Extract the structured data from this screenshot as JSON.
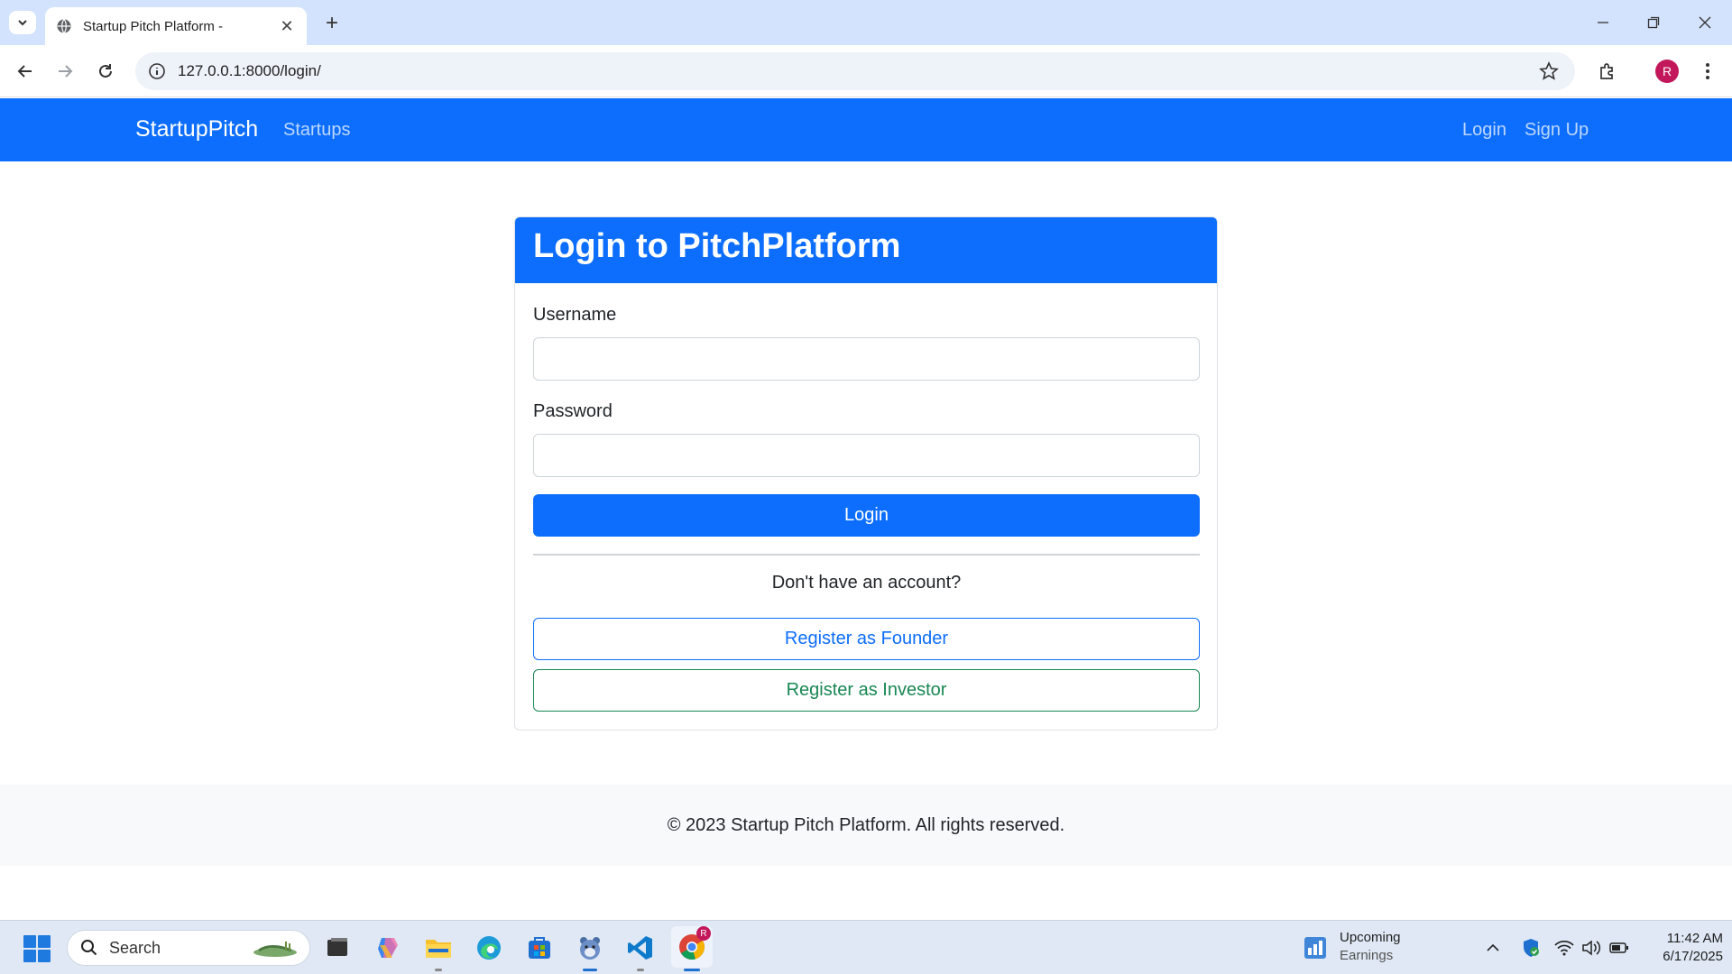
{
  "browser": {
    "tab_title": "Startup Pitch Platform -",
    "url": "127.0.0.1:8000/login/",
    "profile_initial": "R"
  },
  "navbar": {
    "brand": "StartupPitch",
    "links": [
      "Startups"
    ],
    "right_links": [
      "Login",
      "Sign Up"
    ]
  },
  "login_card": {
    "title": "Login to PitchPlatform",
    "username_label": "Username",
    "username_value": "",
    "password_label": "Password",
    "password_value": "",
    "login_button": "Login",
    "no_account_text": "Don't have an account?",
    "register_founder": "Register as Founder",
    "register_investor": "Register as Investor"
  },
  "footer": {
    "text": "© 2023 Startup Pitch Platform. All rights reserved."
  },
  "taskbar": {
    "search_label": "Search",
    "widget_title": "Upcoming",
    "widget_subtitle": "Earnings",
    "time": "11:42 AM",
    "date": "6/17/2025",
    "chrome_badge": "R"
  },
  "colors": {
    "primary": "#0d6efd",
    "success": "#198754",
    "footer_bg": "#f8f9fa"
  }
}
